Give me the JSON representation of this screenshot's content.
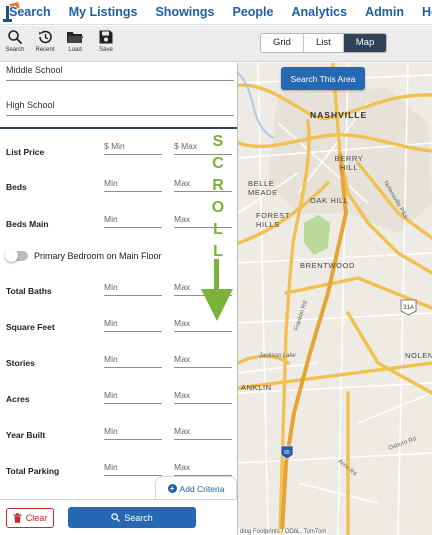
{
  "nav": {
    "items": [
      "Search",
      "My Listings",
      "Showings",
      "People",
      "Analytics",
      "Admin",
      "Help"
    ]
  },
  "toolbar": {
    "tools": [
      {
        "label": "Search",
        "icon": "search-icon"
      },
      {
        "label": "Recent",
        "icon": "history-icon"
      },
      {
        "label": "Load",
        "icon": "folder-icon"
      },
      {
        "label": "Save",
        "icon": "save-icon"
      }
    ],
    "views": [
      "Grid",
      "List",
      "Map"
    ],
    "active_view": "Map"
  },
  "schools": {
    "middle": "Middle School",
    "high": "High School"
  },
  "criteria": [
    {
      "label": "List Price",
      "min": "$  Min",
      "max": "$  Max"
    },
    {
      "label": "Beds",
      "min": "Min",
      "max": "Max"
    },
    {
      "label": "Beds Main",
      "min": "Min",
      "max": "Max"
    },
    {
      "label": "Total Baths",
      "min": "Min",
      "max": "Max"
    },
    {
      "label": "Square Feet",
      "min": "Min",
      "max": "Max"
    },
    {
      "label": "Stories",
      "min": "Min",
      "max": "Max"
    },
    {
      "label": "Acres",
      "min": "Min",
      "max": "Max"
    },
    {
      "label": "Year Built",
      "min": "Min",
      "max": "Max"
    },
    {
      "label": "Total Parking",
      "min": "Min",
      "max": "Max"
    }
  ],
  "toggle": {
    "label": "Primary Bedroom on Main Floor",
    "on": false
  },
  "scroll_hint": [
    "S",
    "C",
    "R",
    "O",
    "L",
    "L"
  ],
  "buttons": {
    "add_criteria": "Add Criteria",
    "clear": "Clear",
    "search": "Search",
    "search_area": "Search This Area"
  },
  "map": {
    "labels": [
      "NASHVILLE",
      "BERRY HILL",
      "BELLE MEADE",
      "OAK HILL",
      "FOREST HILLS",
      "BRENTWOOD",
      "NOLEN",
      "ANKLIN",
      "Jackson Lake",
      "Franklin Rd",
      "Nolensville Pike",
      "Osburn Rd",
      "Arno Rd"
    ],
    "shields": [
      "31A",
      "65"
    ],
    "attribution": "ding Footprints / ODbL, TomTom"
  },
  "colors": {
    "nav_text": "#1d5fa6",
    "active_view": "#2f4256",
    "primary_button": "#2569b5",
    "clear_button": "#c42a2a",
    "scroll_hint": "#7bb23a"
  }
}
